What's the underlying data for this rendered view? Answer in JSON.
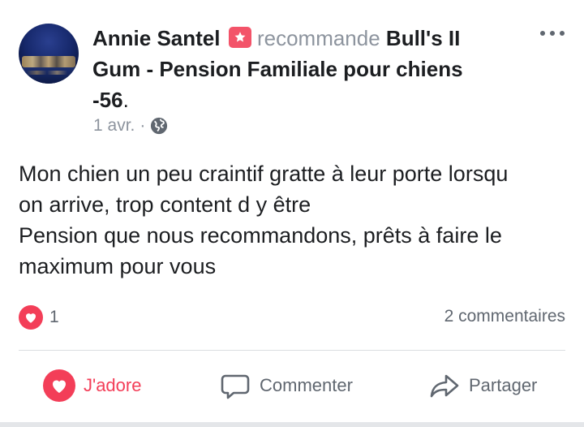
{
  "post": {
    "author": "Annie Santel",
    "verb": "recommande",
    "page_name_line1": "Bull's II",
    "page_name_line2": "Gum - Pension Familiale pour chiens",
    "page_name_line3": "-56",
    "page_name_suffix": ".",
    "date": "1 avr.",
    "date_separator": "·",
    "body_lines": [
      "Mon chien un peu craintif gratte à leur porte lorsqu",
      "on arrive, trop content d y être",
      "Pension que nous recommandons, prêts à faire le",
      "maximum pour vous"
    ],
    "reaction_count": "1",
    "comments_count": "2 commentaires"
  },
  "actions": {
    "love_label": "J'adore",
    "comment_label": "Commenter",
    "share_label": "Partager"
  },
  "colors": {
    "accent_red": "#f33e58",
    "text_primary": "#1c1e21",
    "text_secondary": "#606770",
    "badge_pink": "#f35369"
  },
  "icons": [
    "recommend-badge-icon",
    "more-options-icon",
    "globe-icon",
    "heart-icon",
    "comment-icon",
    "share-icon"
  ]
}
